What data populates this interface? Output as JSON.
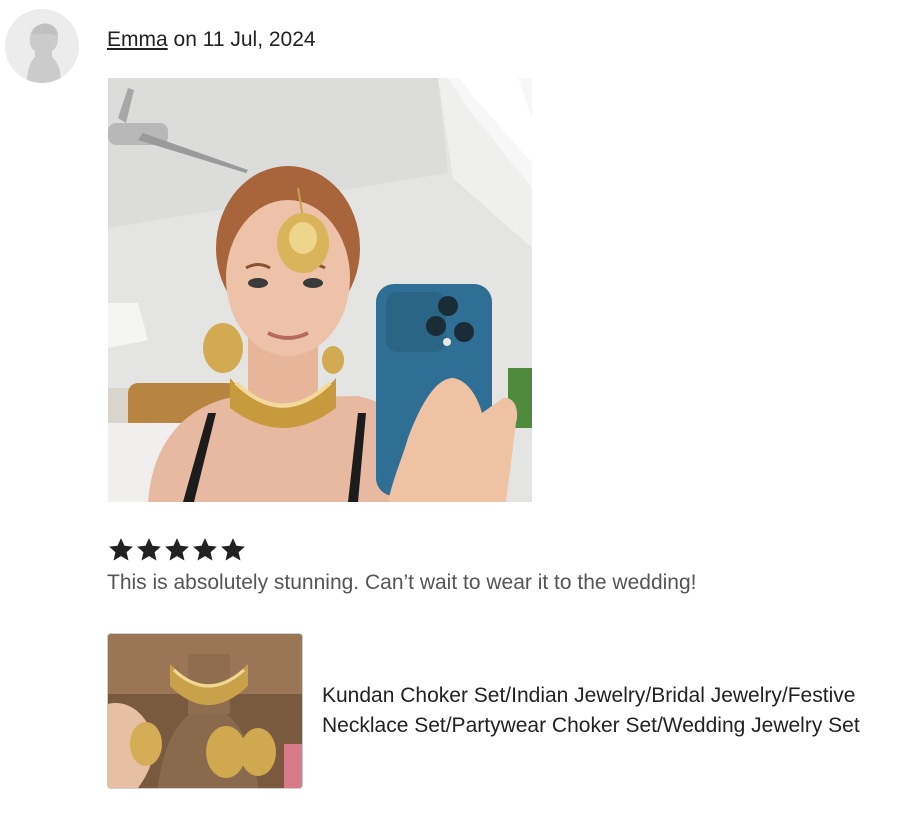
{
  "review": {
    "author": "Emma",
    "date_text": "on 11 Jul, 2024",
    "rating": 5,
    "rating_max": 5,
    "text": "This is absolutely stunning. Can’t wait to wear it to the wedding!",
    "photo_icon": "review-photo",
    "star_color": "#222222"
  },
  "product": {
    "title": "Kundan Choker Set/Indian Jewelry/Bridal Jewelry/Festive Necklace Set/Partywear Choker Set/Wedding Jewelry Set",
    "thumb_icon": "product-thumbnail"
  }
}
